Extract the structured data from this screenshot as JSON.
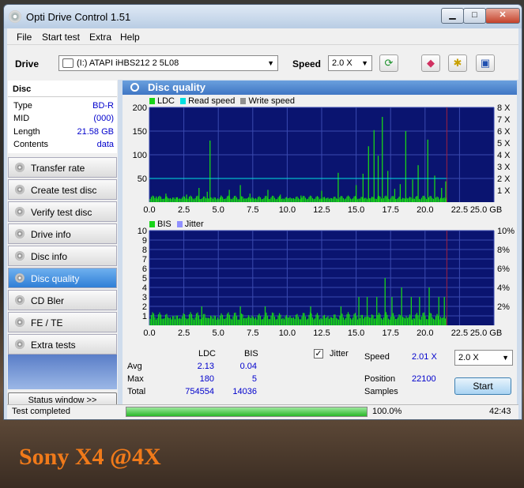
{
  "window": {
    "title": "Opti Drive Control 1.51",
    "minimize": "▁",
    "maximize": "□",
    "close": "✕"
  },
  "menu": [
    "File",
    "Start test",
    "Extra",
    "Help"
  ],
  "toolbar": {
    "drive_label": "Drive",
    "drive_value": "(I:)   ATAPI iHBS212   2 5L08",
    "speed_label": "Speed",
    "speed_value": "2.0 X",
    "icons": [
      "refresh-icon",
      "eraser-icon",
      "settings-icon",
      "save-icon"
    ]
  },
  "disc": {
    "header": "Disc",
    "rows": [
      {
        "key": "Type",
        "value": "BD-R"
      },
      {
        "key": "MID",
        "value": "(000)"
      },
      {
        "key": "Length",
        "value": "21.58 GB"
      },
      {
        "key": "Contents",
        "value": "data"
      }
    ]
  },
  "nav": [
    "Transfer rate",
    "Create test disc",
    "Verify test disc",
    "Drive info",
    "Disc info",
    "Disc quality",
    "CD Bler",
    "FE / TE",
    "Extra tests"
  ],
  "nav_active": "Disc quality",
  "status_window_button": "Status window >>",
  "panel_title": "Disc quality",
  "colors": {
    "plot_bg": "#0a1470",
    "ldc": "#18d418",
    "read": "#00e0e0",
    "write": "#909090",
    "jitter": "#9090ff",
    "grid": "#3a4ab0"
  },
  "chart_data": [
    {
      "type": "bar",
      "legend": [
        "LDC",
        "Read speed",
        "Write speed"
      ],
      "x_ticks": [
        "0.0",
        "2.5",
        "5.0",
        "7.5",
        "10.0",
        "12.5",
        "15.0",
        "17.5",
        "20.0",
        "22.5",
        "25.0 GB"
      ],
      "y_ticks_left": [
        "200",
        "150",
        "100",
        "50"
      ],
      "y_ticks_right": [
        "8 X",
        "7 X",
        "6 X",
        "5 X",
        "4 X",
        "3 X",
        "2 X",
        "1 X"
      ],
      "xlim": [
        0,
        25
      ],
      "ylim": [
        0,
        200
      ],
      "y2lim": [
        0,
        8
      ],
      "read_speed_x": 2.0,
      "spikes": [
        {
          "x": 0.5,
          "y": 12
        },
        {
          "x": 1.2,
          "y": 18
        },
        {
          "x": 2.0,
          "y": 10
        },
        {
          "x": 2.7,
          "y": 16
        },
        {
          "x": 3.6,
          "y": 30
        },
        {
          "x": 4.2,
          "y": 22
        },
        {
          "x": 4.4,
          "y": 130
        },
        {
          "x": 5.2,
          "y": 14
        },
        {
          "x": 5.8,
          "y": 26
        },
        {
          "x": 6.6,
          "y": 36
        },
        {
          "x": 7.3,
          "y": 18
        },
        {
          "x": 8.6,
          "y": 26
        },
        {
          "x": 9.5,
          "y": 16
        },
        {
          "x": 11.0,
          "y": 14
        },
        {
          "x": 12.5,
          "y": 24
        },
        {
          "x": 13.7,
          "y": 62
        },
        {
          "x": 15.0,
          "y": 36
        },
        {
          "x": 15.5,
          "y": 60
        },
        {
          "x": 15.9,
          "y": 118
        },
        {
          "x": 16.3,
          "y": 152
        },
        {
          "x": 16.6,
          "y": 98
        },
        {
          "x": 16.9,
          "y": 180
        },
        {
          "x": 17.3,
          "y": 66
        },
        {
          "x": 17.8,
          "y": 28
        },
        {
          "x": 18.2,
          "y": 38
        },
        {
          "x": 18.6,
          "y": 150
        },
        {
          "x": 19.1,
          "y": 48
        },
        {
          "x": 19.5,
          "y": 78
        },
        {
          "x": 20.2,
          "y": 132
        },
        {
          "x": 20.7,
          "y": 56
        },
        {
          "x": 21.2,
          "y": 30
        },
        {
          "x": 21.5,
          "y": 44
        }
      ],
      "data_end_x": 21.58
    },
    {
      "type": "bar",
      "legend": [
        "BIS",
        "Jitter"
      ],
      "x_ticks": [
        "0.0",
        "2.5",
        "5.0",
        "7.5",
        "10.0",
        "12.5",
        "15.0",
        "17.5",
        "20.0",
        "22.5",
        "25.0 GB"
      ],
      "y_ticks_left": [
        "10",
        "9",
        "8",
        "7",
        "6",
        "5",
        "4",
        "3",
        "2",
        "1"
      ],
      "y_ticks_right": [
        "10%",
        "8%",
        "6%",
        "4%",
        "2%"
      ],
      "xlim": [
        0,
        25
      ],
      "ylim": [
        0,
        10
      ],
      "spikes": [
        {
          "x": 3.8,
          "y": 2
        },
        {
          "x": 6.6,
          "y": 2
        },
        {
          "x": 8.4,
          "y": 2
        },
        {
          "x": 11.7,
          "y": 2
        },
        {
          "x": 13.9,
          "y": 2
        },
        {
          "x": 15.2,
          "y": 3
        },
        {
          "x": 15.8,
          "y": 3
        },
        {
          "x": 16.5,
          "y": 3
        },
        {
          "x": 17.1,
          "y": 5
        },
        {
          "x": 17.6,
          "y": 3
        },
        {
          "x": 18.3,
          "y": 4
        },
        {
          "x": 19.0,
          "y": 3
        },
        {
          "x": 19.6,
          "y": 3
        },
        {
          "x": 20.3,
          "y": 4
        },
        {
          "x": 21.0,
          "y": 3
        },
        {
          "x": 21.4,
          "y": 3
        }
      ],
      "data_end_x": 21.58
    }
  ],
  "stats": {
    "col_ldc": "LDC",
    "col_bis": "BIS",
    "rows": [
      {
        "key": "Avg",
        "ldc": "2.13",
        "bis": "0.04"
      },
      {
        "key": "Max",
        "ldc": "180",
        "bis": "5"
      },
      {
        "key": "Total",
        "ldc": "754554",
        "bis": "14036"
      }
    ],
    "jitter_label": "Jitter",
    "jitter_checked": "✓",
    "speed_label": "Speed",
    "speed_value": "2.01 X",
    "speed_select": "2.0 X",
    "position_label": "Position",
    "position_value": "22100",
    "samples_label": "Samples",
    "start_button": "Start"
  },
  "statusbar": {
    "text": "Test completed",
    "progress": 100,
    "progress_text": "100.0%",
    "time": "42:43"
  },
  "caption": "Sony X4 @4X"
}
